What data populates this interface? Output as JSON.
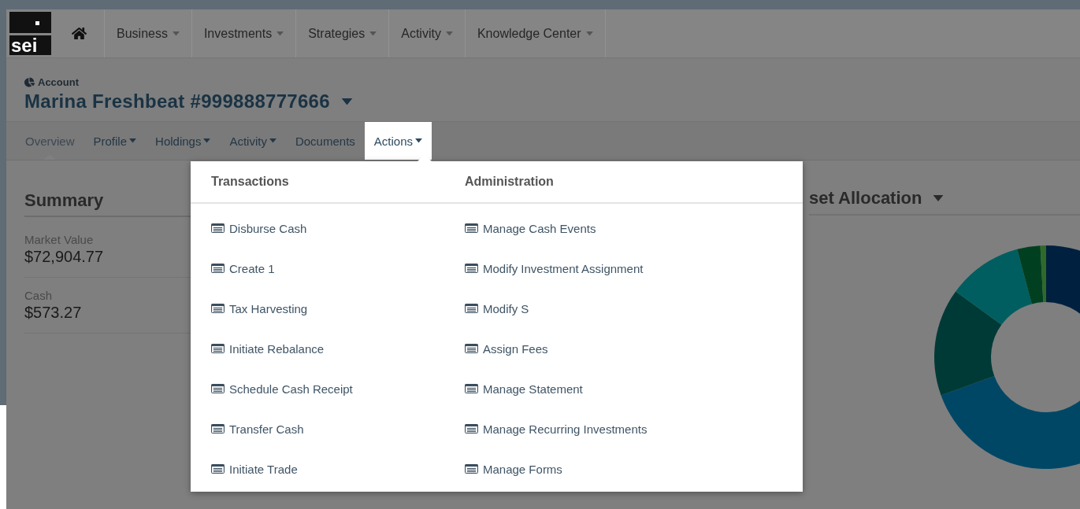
{
  "logo": {
    "text": "sei"
  },
  "nav": {
    "items": [
      {
        "label": "Business"
      },
      {
        "label": "Investments"
      },
      {
        "label": "Strategies"
      },
      {
        "label": "Activity"
      },
      {
        "label": "Knowledge Center"
      }
    ]
  },
  "account": {
    "label": "Account",
    "title": "Marina Freshbeat #999888777666"
  },
  "subnav": {
    "tabs": [
      {
        "label": "Overview",
        "dropdown": false,
        "selected": true,
        "open": false
      },
      {
        "label": "Profile",
        "dropdown": true,
        "selected": false,
        "open": false
      },
      {
        "label": "Holdings",
        "dropdown": true,
        "selected": false,
        "open": false
      },
      {
        "label": "Activity",
        "dropdown": true,
        "selected": false,
        "open": false
      },
      {
        "label": "Documents",
        "dropdown": false,
        "selected": false,
        "open": false
      },
      {
        "label": "Actions",
        "dropdown": true,
        "selected": false,
        "open": true
      }
    ]
  },
  "summary": {
    "title": "Summary",
    "metrics": [
      {
        "label": "Market Value",
        "value": "$72,904.77"
      },
      {
        "label": "Cash",
        "value": "$573.27"
      }
    ]
  },
  "asset_allocation": {
    "title": "set Allocation"
  },
  "actions_menu": {
    "columns": [
      {
        "heading": "Transactions",
        "items": [
          "Disburse Cash",
          "Create 1",
          "Tax Harvesting",
          "Initiate Rebalance",
          "Schedule Cash Receipt",
          "Transfer Cash",
          "Initiate Trade"
        ]
      },
      {
        "heading": "Administration",
        "items": [
          "Manage Cash Events",
          "Modify Investment Assignment",
          "Modify S",
          "Assign Fees",
          "Manage Statement",
          "Manage Recurring Investments",
          "Manage Forms"
        ]
      }
    ]
  }
}
